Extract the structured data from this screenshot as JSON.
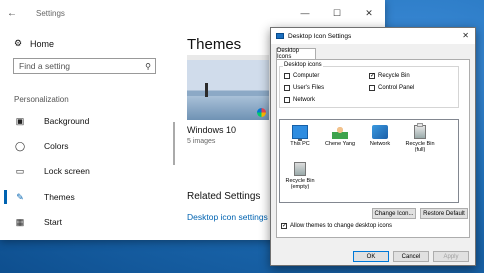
{
  "settings": {
    "window_title": "Settings",
    "controls": [
      "—",
      "☐",
      "✕"
    ],
    "home_label": "Home",
    "search_placeholder": "Find a setting",
    "section_label": "Personalization",
    "nav_items": [
      {
        "label": "Background",
        "icon": "image-icon"
      },
      {
        "label": "Colors",
        "icon": "palette-icon"
      },
      {
        "label": "Lock screen",
        "icon": "lock-screen-icon"
      },
      {
        "label": "Themes",
        "icon": "brush-icon",
        "selected": true
      },
      {
        "label": "Start",
        "icon": "start-icon"
      }
    ],
    "page_title": "Themes",
    "theme_name": "Windows 10",
    "theme_count": "5 images",
    "related_title": "Related Settings",
    "desktop_icon_link": "Desktop icon settings",
    "accent": "#0063b1"
  },
  "dialog": {
    "title": "Desktop Icon Settings",
    "tab": "Desktop Icons",
    "group_label": "Desktop icons",
    "checkboxes": [
      {
        "label": "Computer",
        "checked": false
      },
      {
        "label": "Recycle Bin",
        "checked": true
      },
      {
        "label": "User's Files",
        "checked": false
      },
      {
        "label": "Control Panel",
        "checked": false
      },
      {
        "label": "Network",
        "checked": false
      }
    ],
    "icons": [
      {
        "label": "This PC",
        "icon": "this-pc-icon"
      },
      {
        "label": "Chene Yang",
        "icon": "user-files-icon"
      },
      {
        "label": "Network",
        "icon": "network-icon"
      },
      {
        "label": "Recycle Bin (full)",
        "icon": "recycle-bin-full-icon"
      },
      {
        "label": "Recycle Bin (empty)",
        "icon": "recycle-bin-empty-icon"
      }
    ],
    "change_icon": "Change Icon...",
    "restore_default": "Restore Default",
    "allow_themes": "Allow themes to change desktop icons",
    "allow_themes_checked": true,
    "ok": "OK",
    "cancel": "Cancel",
    "apply": "Apply"
  }
}
